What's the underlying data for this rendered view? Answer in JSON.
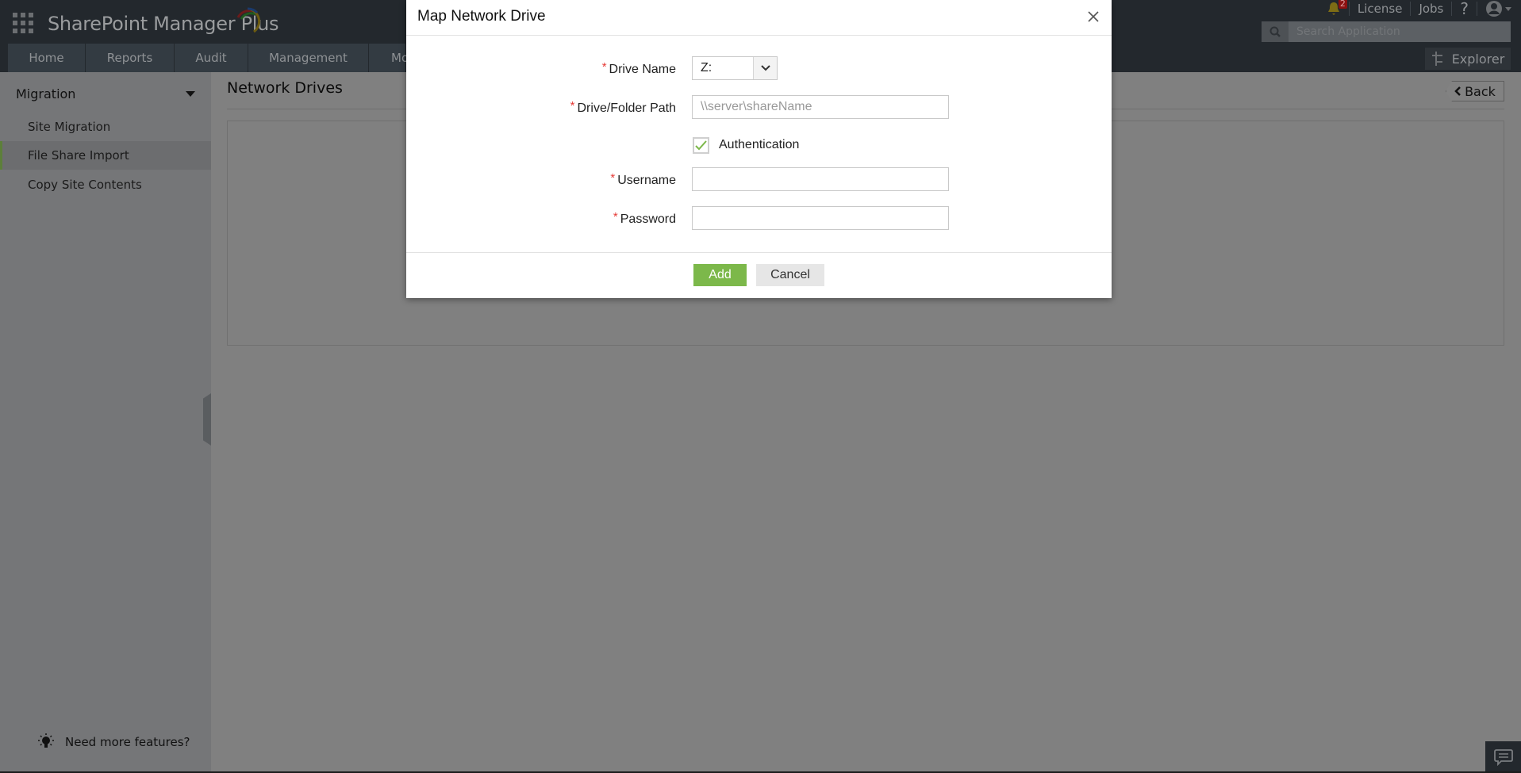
{
  "app": {
    "title": "SharePoint Manager Plus",
    "accent": "#7cb84a"
  },
  "header": {
    "links": [
      "License",
      "Jobs",
      "?"
    ],
    "notification_count": "2",
    "search_placeholder": "Search Application",
    "explorer_label": "Explorer"
  },
  "nav": {
    "tabs": [
      "Home",
      "Reports",
      "Audit",
      "Management",
      "Mo"
    ]
  },
  "sidebar": {
    "section": "Migration",
    "items": [
      {
        "label": "Site Migration",
        "active": false
      },
      {
        "label": "File Share Import",
        "active": true
      },
      {
        "label": "Copy Site Contents",
        "active": false
      }
    ],
    "footer": "Need more features?"
  },
  "main": {
    "title": "Network Drives",
    "back_label": "Back"
  },
  "modal": {
    "title": "Map Network Drive",
    "fields": {
      "drive_name": {
        "label": "Drive Name",
        "value": "Z:"
      },
      "path": {
        "label": "Drive/Folder Path",
        "placeholder": "\\\\server\\shareName",
        "value": ""
      },
      "auth": {
        "label": "Authentication",
        "checked": true
      },
      "username": {
        "label": "Username",
        "value": ""
      },
      "password": {
        "label": "Password",
        "value": ""
      }
    },
    "required_mark": "*",
    "add_label": "Add",
    "cancel_label": "Cancel"
  }
}
